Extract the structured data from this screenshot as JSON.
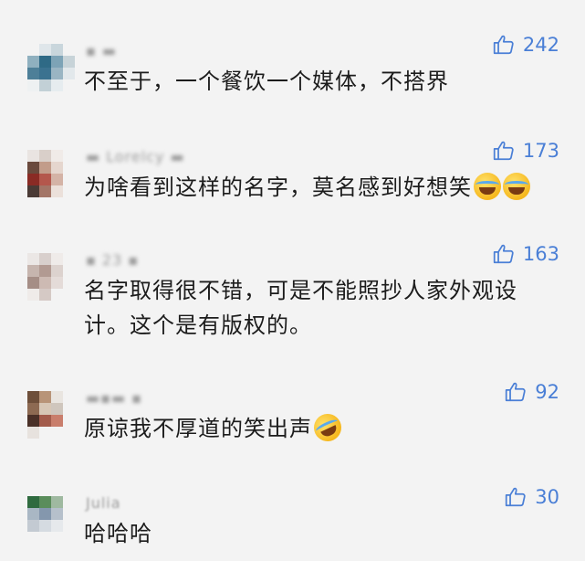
{
  "comments": [
    {
      "username": "▪ ▬",
      "likes": "242",
      "text": "不至于，一个餐饮一个媒体，不搭界",
      "avatar_colors": [
        "#f3f3f3",
        "#dfe6ea",
        "#c9d6dc",
        "#f3f3f3",
        "#8fb0bf",
        "#2f6a86",
        "#7da3b6",
        "#c7d3d8",
        "#4d7f98",
        "#3b7290",
        "#9ab5c3",
        "#e2e8eb",
        "#eef1f2",
        "#c2d0d6",
        "#e6ecef",
        "#f3f3f3"
      ]
    },
    {
      "username": "▬ Lorelcy ▬",
      "likes": "173",
      "text": "为啥看到这样的名字，莫名感到好想笑",
      "emojis": [
        "face-with-tears-of-joy-emoji",
        "face-with-tears-of-joy-emoji"
      ],
      "avatar_colors": [
        "#e9e4e1",
        "#d9cfc9",
        "#f0ebe8",
        "#f3f3f3",
        "#6a4a3d",
        "#c29c8a",
        "#e5d6ce",
        "#f3f3f3",
        "#8a2b25",
        "#b4574c",
        "#d4b3a6",
        "#f3f3f3",
        "#4a3a35",
        "#a37567",
        "#ebe0da",
        "#f3f3f3"
      ]
    },
    {
      "username": "▪ 23 ▪",
      "likes": "163",
      "text": "名字取得很不错，可是不能照抄人家外观设计。这个是有版权的。",
      "avatar_colors": [
        "#ebe7e5",
        "#d8cfcc",
        "#efebe9",
        "#f3f3f3",
        "#c6b5ae",
        "#b29a92",
        "#dcd2ce",
        "#f3f3f3",
        "#a58e86",
        "#cdbab3",
        "#e4dbd8",
        "#f3f3f3",
        "#efebe9",
        "#d5c9c5",
        "#f3f3f3",
        "#f3f3f3"
      ]
    },
    {
      "username": "▬▪▬ ▪",
      "likes": "92",
      "text": "原谅我不厚道的笑出声",
      "emojis": [
        "rolling-on-floor-laughing-emoji"
      ],
      "avatar_colors": [
        "#6e4f3a",
        "#b89478",
        "#e9e5e0",
        "#f3f3f3",
        "#8d6a52",
        "#d7c7b6",
        "#cfc6bd",
        "#f3f3f3",
        "#4a3027",
        "#a35c4c",
        "#c97e6c",
        "#f3f3f3",
        "#e7e2de",
        "#f3f3f3",
        "#f3f3f3",
        "#f3f3f3"
      ]
    },
    {
      "username": "Julia",
      "likes": "30",
      "text": "哈哈哈",
      "avatar_colors": [
        "#2f6b3f",
        "#5a8d5b",
        "#9fb9a0",
        "#f3f3f3",
        "#a9b7c4",
        "#8497ad",
        "#b6c0cb",
        "#f3f3f3",
        "#c3cad2",
        "#d5dbe1",
        "#e6e9ec",
        "#f3f3f3",
        "#f3f3f3",
        "#f3f3f3",
        "#f3f3f3",
        "#f3f3f3"
      ]
    }
  ],
  "colors": {
    "like_blue": "#4a7fd6",
    "background": "#f3f3f3"
  },
  "icons": {
    "like": "thumbs-up-icon"
  }
}
